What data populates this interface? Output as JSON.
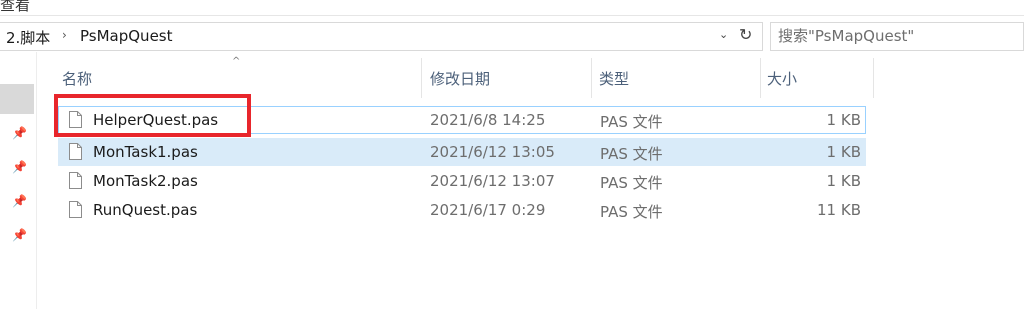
{
  "ribbon": {
    "tab_label": "查看"
  },
  "address_bar": {
    "crumbs": [
      "2.脚本",
      "PsMapQuest"
    ],
    "separator": "›",
    "dropdown_glyph": "⌄",
    "refresh_glyph": "↻"
  },
  "search": {
    "placeholder": "搜索\"PsMapQuest\""
  },
  "columns": {
    "name": "名称",
    "date": "修改日期",
    "type": "类型",
    "size": "大小"
  },
  "sort_indicator": "^",
  "sidebar": {
    "pin_glyph": "📌"
  },
  "files": [
    {
      "name": "HelperQuest.pas",
      "date": "2021/6/8 14:25",
      "type": "PAS 文件",
      "size": "1 KB"
    },
    {
      "name": "MonTask1.pas",
      "date": "2021/6/12 13:05",
      "type": "PAS 文件",
      "size": "1 KB"
    },
    {
      "name": "MonTask2.pas",
      "date": "2021/6/12 13:07",
      "type": "PAS 文件",
      "size": "1 KB"
    },
    {
      "name": "RunQuest.pas",
      "date": "2021/6/17 0:29",
      "type": "PAS 文件",
      "size": "11 KB"
    }
  ],
  "colors": {
    "highlight": "#e8262c",
    "selection": "#d9ebf9",
    "focus_border": "#99d1ff",
    "header_text": "#4c607a"
  }
}
